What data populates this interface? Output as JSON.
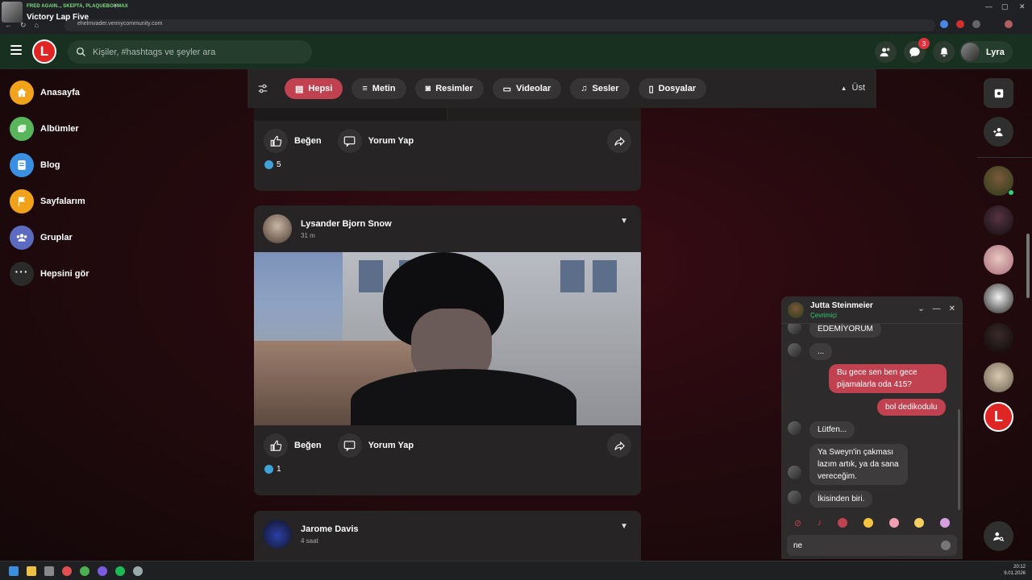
{
  "browser": {
    "now_playing_artists": "FRED AGAIN.., SKEPTA, PLAQUEBOYMAX",
    "now_playing_title": "Victory Lap Five",
    "url": "ehelmvader.vennycommunity.com"
  },
  "header": {
    "search_placeholder": "Kişiler, #hashtags ve şeyler ara",
    "notification_count": "3",
    "user_name": "Lyra"
  },
  "sidebar": {
    "items": [
      {
        "label": "Anasayfa",
        "color": "#f0a31a",
        "icon": "home-icon"
      },
      {
        "label": "Albümler",
        "color": "#58b55b",
        "icon": "album-icon"
      },
      {
        "label": "Blog",
        "color": "#3a8fe0",
        "icon": "blog-icon"
      },
      {
        "label": "Sayfalarım",
        "color": "#f0a31a",
        "icon": "flag-icon"
      },
      {
        "label": "Gruplar",
        "color": "#5c6bc0",
        "icon": "groups-icon"
      },
      {
        "label": "Hepsini gör",
        "color": "#2a2a2a",
        "icon": "more-icon"
      }
    ]
  },
  "filters": {
    "tabs": [
      "Hepsi",
      "Metin",
      "Resimler",
      "Videolar",
      "Sesler",
      "Dosyalar"
    ],
    "active": "Hepsi",
    "top_label": "Üst"
  },
  "feed": {
    "like_label": "Beğen",
    "comment_label": "Yorum Yap",
    "posts": [
      {
        "likes": "5"
      },
      {
        "author": "Lysander Bjorn Snow",
        "time": "31 m",
        "likes": "1"
      },
      {
        "author": "Jarome Davis",
        "time": "4 saat"
      }
    ]
  },
  "chat": {
    "contact": "Jutta Steinmeier",
    "status": "Çevrimiçi",
    "messages": [
      {
        "dir": "in",
        "text": "EDEMİYORUM"
      },
      {
        "dir": "in",
        "text": "..."
      },
      {
        "dir": "out",
        "text": "Bu gece sen ben gece pijamalarla oda 415?"
      },
      {
        "dir": "out",
        "text": "bol dedikodulu"
      },
      {
        "dir": "in",
        "text": "Lütfen..."
      },
      {
        "dir": "in",
        "text": "Ya Sweyn'in çakması lazım artık, ya da sana vereceğim."
      },
      {
        "dir": "in",
        "text": "İkisinden biri."
      }
    ],
    "input_value": "ne"
  },
  "taskbar": {
    "time": "20:12",
    "date": "9.01.2026"
  },
  "colors": {
    "accent": "#c0414f",
    "header_bg": "#17301f",
    "online": "#2ed573"
  }
}
